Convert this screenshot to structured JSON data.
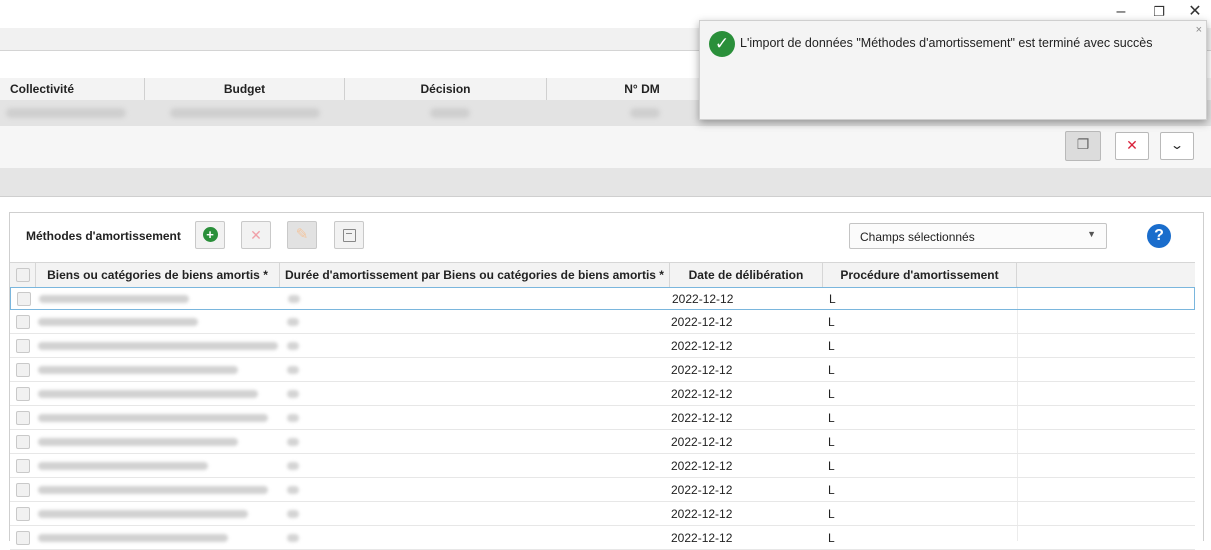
{
  "window": {
    "minimize": "–",
    "restore": "❐",
    "close": "✕"
  },
  "context_table": {
    "headers": [
      "Collectivité",
      "Budget",
      "Décision",
      "N° DM"
    ]
  },
  "notification": {
    "message": "L'import de données \"Méthodes d'amortissement\" est terminé avec succès",
    "close": "×",
    "status_color": "#2a8f3a"
  },
  "toolbar": {
    "copy_icon": "copy-icon",
    "delete_icon": "✕",
    "expand_icon": "⌄"
  },
  "panel": {
    "title": "Méthodes d'amortissement",
    "fields_select": "Champs sélectionnés",
    "help": "?"
  },
  "grid": {
    "columns": [
      "Biens ou catégories de biens amortis *",
      "Durée d'amortissement par Biens ou catégories de biens amortis *",
      "Date de délibération",
      "Procédure d'amortissement"
    ],
    "rows": [
      {
        "date": "2022-12-12",
        "procedure": "L"
      },
      {
        "date": "2022-12-12",
        "procedure": "L"
      },
      {
        "date": "2022-12-12",
        "procedure": "L"
      },
      {
        "date": "2022-12-12",
        "procedure": "L"
      },
      {
        "date": "2022-12-12",
        "procedure": "L"
      },
      {
        "date": "2022-12-12",
        "procedure": "L"
      },
      {
        "date": "2022-12-12",
        "procedure": "L"
      },
      {
        "date": "2022-12-12",
        "procedure": "L"
      },
      {
        "date": "2022-12-12",
        "procedure": "L"
      },
      {
        "date": "2022-12-12",
        "procedure": "L"
      },
      {
        "date": "2022-12-12",
        "procedure": "L"
      }
    ]
  }
}
